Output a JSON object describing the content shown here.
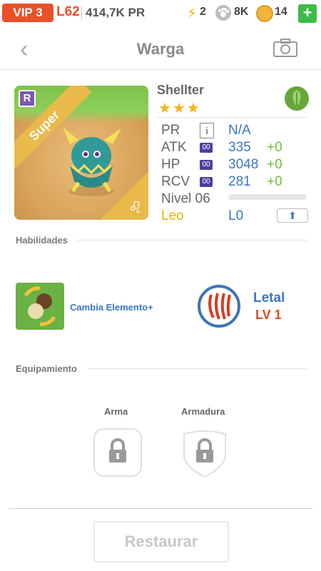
{
  "status": {
    "vip": "VIP 3",
    "level": "L62",
    "pr": "414,7K PR",
    "energy": "2",
    "pets": "8K",
    "coins": "14",
    "plus": "+"
  },
  "header": {
    "title": "Warga"
  },
  "card": {
    "rarity_tag": "R",
    "ribbon": "Super"
  },
  "monster": {
    "name": "Shellter",
    "stars": "★★★",
    "pr_label": "PR",
    "pr_icon": "i",
    "pr_value": "N/A",
    "atk_label": "ATK",
    "atk_badge": "00",
    "atk_value": "335",
    "atk_plus": "+0",
    "hp_label": "HP",
    "hp_badge": "00",
    "hp_value": "3048",
    "hp_plus": "+0",
    "rcv_label": "RCV",
    "rcv_badge": "00",
    "rcv_value": "281",
    "rcv_plus": "+0",
    "level_label": "Nivel 06",
    "sign_label": "Leo",
    "sign_level": "L0"
  },
  "skills": {
    "title": "Habilidades",
    "active_name": "Cambia Elemento+",
    "passive_name": "Letal",
    "passive_level": "LV 1"
  },
  "equipment": {
    "title": "Equipamiento",
    "weapon": "Arma",
    "armor": "Armadura"
  },
  "footer": {
    "restore": "Restaurar"
  },
  "colors": {
    "accent_blue": "#3a76c4",
    "vip_orange": "#e8512a",
    "green": "#3dbb47"
  }
}
